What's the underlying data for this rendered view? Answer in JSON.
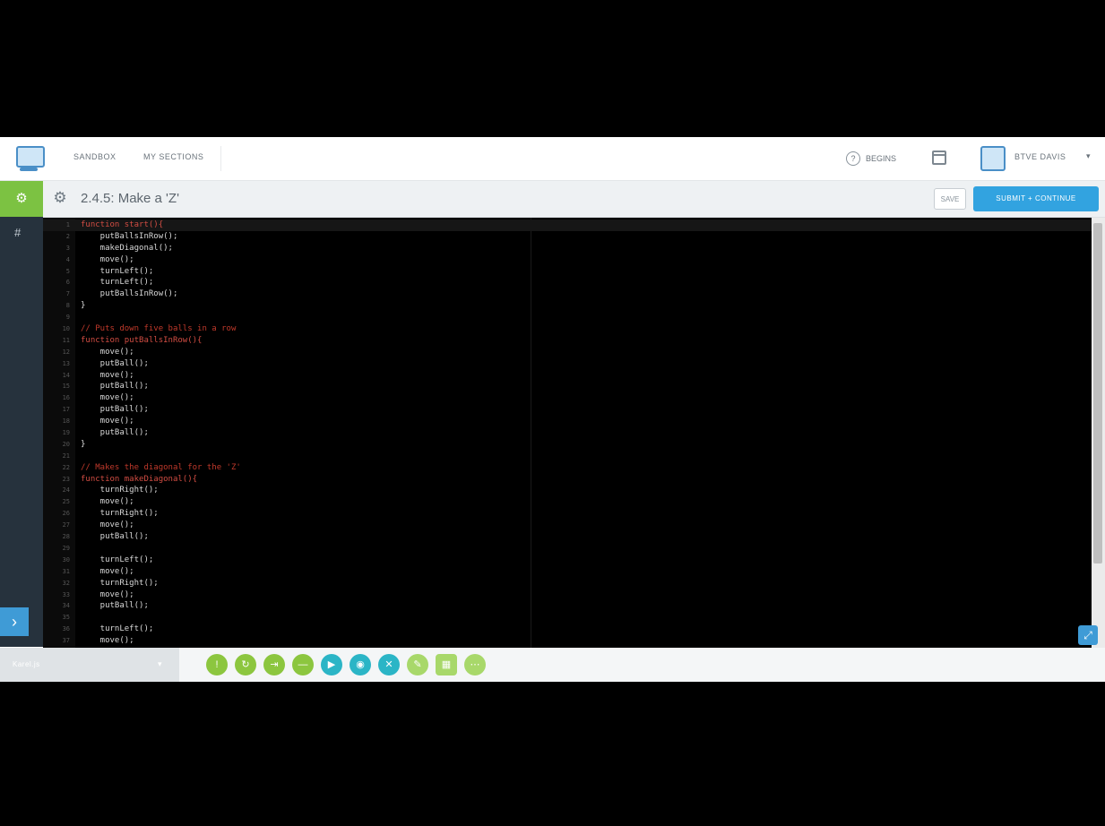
{
  "nav": {
    "links": [
      "SANDBOX",
      "MY SECTIONS"
    ],
    "help_label": "BEGINS",
    "user_name": "BTVE DAVIS"
  },
  "titlebar": {
    "title": "2.4.5: Make a 'Z'",
    "save_label": "SAVE",
    "submit_label": "SUBMIT + CONTINUE"
  },
  "editor": {
    "lines": [
      {
        "n": "1",
        "text": "function start(){",
        "cls": "kw"
      },
      {
        "n": "2",
        "text": "    putBallsInRow();",
        "cls": ""
      },
      {
        "n": "3",
        "text": "    makeDiagonal();",
        "cls": ""
      },
      {
        "n": "4",
        "text": "    move();",
        "cls": ""
      },
      {
        "n": "5",
        "text": "    turnLeft();",
        "cls": ""
      },
      {
        "n": "6",
        "text": "    turnLeft();",
        "cls": ""
      },
      {
        "n": "7",
        "text": "    putBallsInRow();",
        "cls": ""
      },
      {
        "n": "8",
        "text": "}",
        "cls": ""
      },
      {
        "n": "9",
        "text": "",
        "cls": ""
      },
      {
        "n": "10",
        "text": "// Puts down five balls in a row",
        "cls": "cm"
      },
      {
        "n": "11",
        "text": "function putBallsInRow(){",
        "cls": "kw"
      },
      {
        "n": "12",
        "text": "    move();",
        "cls": ""
      },
      {
        "n": "13",
        "text": "    putBall();",
        "cls": ""
      },
      {
        "n": "14",
        "text": "    move();",
        "cls": ""
      },
      {
        "n": "15",
        "text": "    putBall();",
        "cls": ""
      },
      {
        "n": "16",
        "text": "    move();",
        "cls": ""
      },
      {
        "n": "17",
        "text": "    putBall();",
        "cls": ""
      },
      {
        "n": "18",
        "text": "    move();",
        "cls": ""
      },
      {
        "n": "19",
        "text": "    putBall();",
        "cls": ""
      },
      {
        "n": "20",
        "text": "}",
        "cls": ""
      },
      {
        "n": "21",
        "text": "",
        "cls": ""
      },
      {
        "n": "22",
        "text": "// Makes the diagonal for the 'Z'",
        "cls": "cm"
      },
      {
        "n": "23",
        "text": "function makeDiagonal(){",
        "cls": "kw"
      },
      {
        "n": "24",
        "text": "    turnRight();",
        "cls": ""
      },
      {
        "n": "25",
        "text": "    move();",
        "cls": ""
      },
      {
        "n": "26",
        "text": "    turnRight();",
        "cls": ""
      },
      {
        "n": "27",
        "text": "    move();",
        "cls": ""
      },
      {
        "n": "28",
        "text": "    putBall();",
        "cls": ""
      },
      {
        "n": "29",
        "text": "",
        "cls": ""
      },
      {
        "n": "30",
        "text": "    turnLeft();",
        "cls": ""
      },
      {
        "n": "31",
        "text": "    move();",
        "cls": ""
      },
      {
        "n": "32",
        "text": "    turnRight();",
        "cls": ""
      },
      {
        "n": "33",
        "text": "    move();",
        "cls": ""
      },
      {
        "n": "34",
        "text": "    putBall();",
        "cls": ""
      },
      {
        "n": "35",
        "text": "",
        "cls": ""
      },
      {
        "n": "36",
        "text": "    turnLeft();",
        "cls": ""
      },
      {
        "n": "37",
        "text": "    move();",
        "cls": ""
      }
    ]
  },
  "bottombar": {
    "file_label": "Karel.js",
    "controls": [
      {
        "glyph": "!",
        "name": "run-button",
        "style": "g"
      },
      {
        "glyph": "↻",
        "name": "reset-button",
        "style": "g"
      },
      {
        "glyph": "⇥",
        "name": "step-button",
        "style": "g"
      },
      {
        "glyph": "—",
        "name": "docs-button",
        "style": "g"
      },
      {
        "glyph": "▶",
        "name": "play-button",
        "style": "t"
      },
      {
        "glyph": "◉",
        "name": "record-button",
        "style": "t"
      },
      {
        "glyph": "✕",
        "name": "stop-button",
        "style": "t"
      },
      {
        "glyph": "✎",
        "name": "edit-button",
        "style": "l"
      },
      {
        "glyph": "▦",
        "name": "grid-button",
        "style": "l sq"
      },
      {
        "glyph": "⋯",
        "name": "more-button",
        "style": "l"
      }
    ]
  },
  "colors": {
    "accent_green": "#7cc242",
    "accent_blue": "#32a3e0",
    "rail": "#26323d"
  }
}
